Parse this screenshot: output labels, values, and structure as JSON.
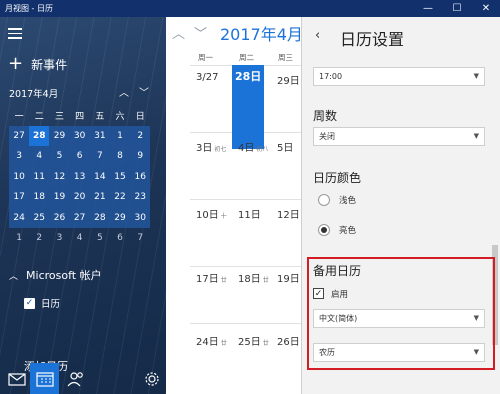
{
  "window": {
    "title": "月视图 - 日历",
    "minimize": "—",
    "maximize": "☐",
    "close": "✕"
  },
  "sidebar": {
    "new_event": "新事件",
    "month_label": "2017年4月",
    "weekday_headers": [
      "一",
      "二",
      "三",
      "四",
      "五",
      "六",
      "日"
    ],
    "days": [
      [
        "27",
        "28",
        "29",
        "30",
        "31",
        "1",
        "2"
      ],
      [
        "3",
        "4",
        "5",
        "6",
        "7",
        "8",
        "9"
      ],
      [
        "10",
        "11",
        "12",
        "13",
        "14",
        "15",
        "16"
      ],
      [
        "17",
        "18",
        "19",
        "20",
        "21",
        "22",
        "23"
      ],
      [
        "24",
        "25",
        "26",
        "27",
        "28",
        "29",
        "30"
      ],
      [
        "1",
        "2",
        "3",
        "4",
        "5",
        "6",
        "7"
      ]
    ],
    "selected_day": "28",
    "account_section": "Microsoft 帐户",
    "calendar_item": "日历",
    "add_calendar": "添加日历"
  },
  "main": {
    "month_title": "2017年4月",
    "weekdays": [
      "周一",
      "周二",
      "周三"
    ],
    "rows": [
      [
        "3/27",
        "28日",
        "29日"
      ],
      [
        "3日",
        "4日",
        "5日"
      ],
      [
        "10日",
        "11日",
        "12日"
      ],
      [
        "17日",
        "18日",
        "19日"
      ],
      [
        "24日",
        "25日",
        "26日"
      ]
    ],
    "lunar": {
      "r1a": "初七",
      "r1b": "初八",
      "r2": "十",
      "r3a": "廿",
      "r3b": "廿",
      "r4a": "廿",
      "r4b": "廿"
    }
  },
  "settings": {
    "title": "日历设置",
    "time_value": "17:00",
    "week_number_title": "周数",
    "week_number_value": "关闭",
    "color_title": "日历颜色",
    "color_light": "浅色",
    "color_dark": "亮色",
    "alt_cal_title": "备用日历",
    "enable_label": "启用",
    "language_value": "中文(简体)",
    "calendar_type_value": "农历"
  },
  "colors": {
    "accent": "#1b73d8",
    "titlebar": "#11306c",
    "highlight_box": "#d31c24"
  }
}
